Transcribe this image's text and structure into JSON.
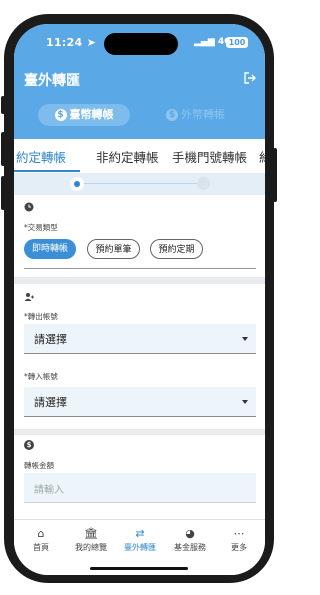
{
  "status_bar": {
    "time": "11:24",
    "network": "4G",
    "battery": "100"
  },
  "header": {
    "title": "臺外轉匯",
    "segments": [
      {
        "label": "臺幣轉帳",
        "active": true
      },
      {
        "label": "外幣轉帳",
        "active": false
      }
    ]
  },
  "tabs": [
    "約定轉帳",
    "非約定轉帳",
    "手機門號轉帳",
    "約"
  ],
  "stepper": {
    "current": 1,
    "total": 2
  },
  "transaction_type": {
    "label": "*交易類型",
    "options": [
      "即時轉帳",
      "預約單筆",
      "預約定期"
    ],
    "selected": "即時轉帳"
  },
  "from_account": {
    "label": "*轉出帳號",
    "value": "請選擇"
  },
  "to_account": {
    "label": "*轉入帳號",
    "value": "請選擇"
  },
  "amount": {
    "label": "轉帳金額",
    "placeholder": "請輸入"
  },
  "bottom_nav": [
    {
      "label": "首頁",
      "icon": "home-icon",
      "active": false
    },
    {
      "label": "我的總覽",
      "icon": "bank-icon",
      "active": false
    },
    {
      "label": "臺外轉匯",
      "icon": "transfer-icon",
      "active": true
    },
    {
      "label": "基金服務",
      "icon": "pie-chart-icon",
      "active": false
    },
    {
      "label": "更多",
      "icon": "more-icon",
      "active": false
    }
  ],
  "colors": {
    "primary": "#5aa8e6",
    "accent": "#2f86cf",
    "field_bg": "#eef5fa"
  }
}
